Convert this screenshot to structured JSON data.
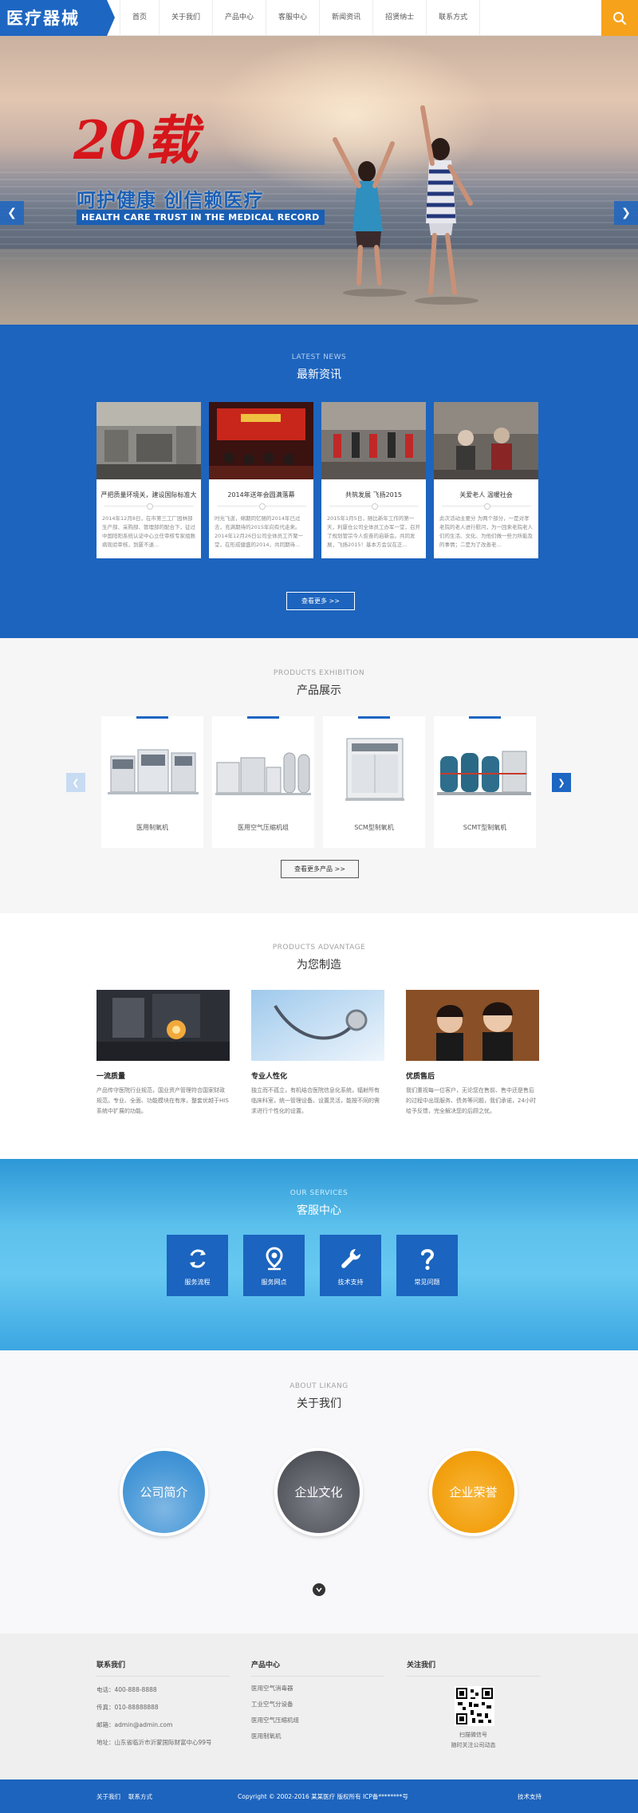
{
  "header": {
    "logo_text": "医疗器械",
    "nav": [
      "首页",
      "关于我们",
      "产品中心",
      "客服中心",
      "新闻资讯",
      "招贤纳士",
      "联系方式"
    ]
  },
  "banner": {
    "year_text": "20载",
    "slogan": "呵护健康  创信赖医疗",
    "slogan_en": "HEALTH CARE TRUST IN THE MEDICAL RECORD"
  },
  "news": {
    "subtitle": "LATEST NEWS",
    "title": "最新资讯",
    "items": [
      {
        "title": "严把质量环境关，建设国际标准大",
        "desc": "2014年12月8日，在市第三工厂园林部生产部、采购部、管理部的配合下，征过中国阳阳系统认证中心立任审核专家组数病现验审核，到厦不退..."
      },
      {
        "title": "2014年送年会圆满落幕",
        "desc": "时光飞逝，绵期同忆随的2014年已过去，充满期待的2015年向有代走来。2014年12月26日公司全体员工齐聚一堂，在形成健盛的2014，共同期待..."
      },
      {
        "title": "共筑发展 飞扬2015",
        "desc": "2015年1月5日，随比新年工作的第一天，利厦仓公司全体员工办军一堂，召开了规划管宗今人愈奋的启新会。共同发展，飞扬2015！基本方会议在正..."
      },
      {
        "title": "关爱老人 温暖社会",
        "desc": "此次活动主要分 为两个部分，一是对孝老院的老人进行慰问，为一回来老院老人们的生活、文化、为他们做一些力所能及的事情；二是为了改善老..."
      }
    ],
    "more_label": "查看更多 >>"
  },
  "products": {
    "subtitle": "PRODUCTS EXHIBITION",
    "title": "产品展示",
    "items": [
      "医用制氧机",
      "医用空气压缩机组",
      "SCM型制氧机",
      "SCMT型制氧机"
    ],
    "more_label": "查看更多产品 >>"
  },
  "advantage": {
    "subtitle": "PRODUCTS ADVANTAGE",
    "title": "为您制造",
    "items": [
      {
        "title": "一流质量",
        "desc": "产品传守医院行业规范，国业资产管理符合国家财政规范。专业、全面、功能模块在有序，整套优越于HIS系统中扩展的功能。"
      },
      {
        "title": "专业人性化",
        "desc": "独立而不孤立，有机结合医院信息化系统，辐射所有临床科室，统一管理设备。设置灵活，能按不同的需求进行个性化的设置。"
      },
      {
        "title": "优质售后",
        "desc": "我们重视每一位客户，无论您在售前、售中还是售后的过程中出现服务、债务等问题，我们承诺，24小时给予反馈，完全解决您的后顾之忧。"
      }
    ]
  },
  "services": {
    "subtitle": "OUR SERVICES",
    "title": "客服中心",
    "items": [
      "服务流程",
      "服务网点",
      "技术支持",
      "常见问题"
    ]
  },
  "about": {
    "subtitle": "ABOUT LIKANG",
    "title": "关于我们",
    "items": [
      "公司简介",
      "企业文化",
      "企业荣誉"
    ]
  },
  "footer": {
    "contact_title": "联系我们",
    "phone": "电话：400-888-8888",
    "fax": "传真：010-88888888",
    "email": "邮箱：admin@admin.com",
    "address": "地址：山东省临沂市沂蒙国际财富中心99号",
    "products_title": "产品中心",
    "product_links": [
      "医用空气消毒器",
      "工业空气分设备",
      "医用空气压缩机组",
      "医用制氧机"
    ],
    "follow_title": "关注我们",
    "qr_line1": "扫描微信号",
    "qr_line2": "随时关注公司动态"
  },
  "bottom": {
    "links": [
      "关于我们",
      "联系方式"
    ],
    "copyright": "Copyright © 2002-2016 某某医疗 版权所有  ICP备********号",
    "right_link": "技术支持"
  },
  "colors": {
    "primary": "#1d66c2",
    "accent": "#f7a21b",
    "year_red": "#d6161b"
  }
}
